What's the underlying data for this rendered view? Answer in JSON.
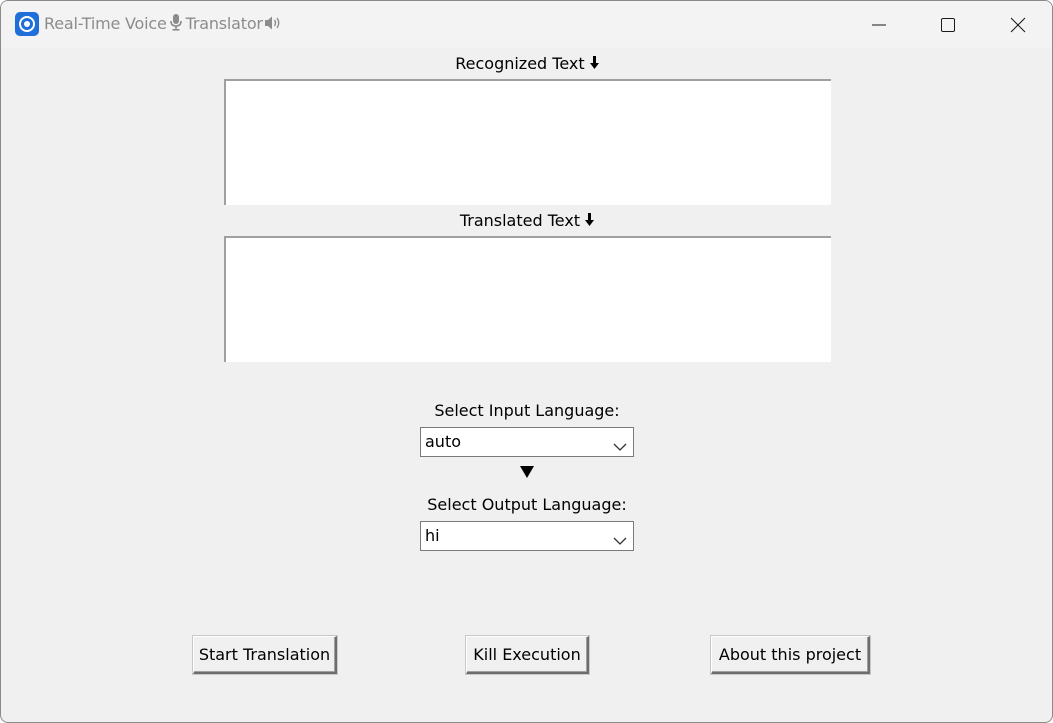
{
  "window": {
    "title_part1": "Real-Time Voice",
    "title_part2": "Translator",
    "controls": {
      "minimize_icon": "minimize-icon",
      "maximize_icon": "maximize-icon",
      "close_icon": "close-icon"
    }
  },
  "recognized": {
    "label": "Recognized Text",
    "label_icon": "down-arrow-icon",
    "value": ""
  },
  "translated": {
    "label": "Translated Text",
    "label_icon": "down-arrow-icon",
    "value": ""
  },
  "input_language": {
    "label": "Select Input Language:",
    "selected": "auto"
  },
  "output_language": {
    "label": "Select Output Language:",
    "selected": "hi"
  },
  "buttons": {
    "start": "Start Translation",
    "kill": "Kill Execution",
    "about": "About this project"
  },
  "colors": {
    "window_bg": "#f0f0f0",
    "app_icon": "#1e6fd9",
    "title_text": "#8c8c8c"
  }
}
